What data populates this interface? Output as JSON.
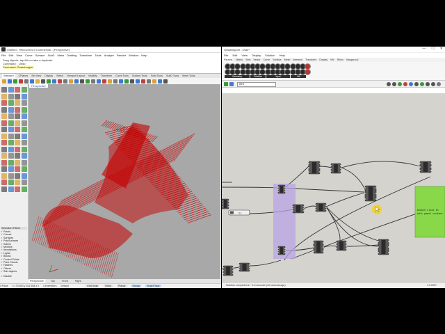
{
  "rhino": {
    "title": "Untitled - Rhinoceros 6 Commercial - [Perspective]",
    "menu": [
      "File",
      "Edit",
      "View",
      "Curve",
      "Surface",
      "SubD",
      "Mesh",
      "Drafting",
      "Transform",
      "Tools",
      "Analyze",
      "Render",
      "Window",
      "Help"
    ],
    "command_history": [
      "Drag objects, tap Alt to make a duplicate",
      "Command: _Undo"
    ],
    "command_prompt": "Command: Grasshopper",
    "toolbar_tabs": [
      "Standard",
      "CPlanes",
      "Set View",
      "Display",
      "Select",
      "Viewport Layout",
      "Visibility",
      "Transform",
      "Curve Tools",
      "Surface Tools",
      "Solid Tools",
      "SubD Tools",
      "Mesh Tools"
    ],
    "viewport_label": "Perspective",
    "viewport_tabs": [
      "Perspective",
      "Top",
      "Front",
      "Right"
    ],
    "selection_filters": {
      "header": "Selection Filters",
      "items": [
        "Points",
        "Curves",
        "Surfaces",
        "PolySurfaces",
        "SubDs",
        "Meshes",
        "Annotations",
        "Lights",
        "Blocks",
        "Control Points",
        "Point Clouds",
        "Hatches",
        "Others",
        "Sub-objects"
      ],
      "disable": "Disable"
    },
    "status": {
      "cplane": "CPlane",
      "coords": "x 179.853  y 161.658  z 0",
      "units": "Centimeters",
      "layer": "Default",
      "toggles": [
        "Grid Snap",
        "Ortho",
        "Planar",
        "Osnap",
        "SmartTrack"
      ]
    },
    "geometry_color": "#c40000"
  },
  "gh": {
    "title": "Grasshopper - chair*",
    "window_buttons": [
      "—",
      "☐",
      "✕"
    ],
    "menu": [
      "File",
      "Edit",
      "View",
      "Display",
      "Solution",
      "Help"
    ],
    "tabs": [
      "Params",
      "Maths",
      "Sets",
      "Vector",
      "Curve",
      "Surface",
      "Mesh",
      "Intersect",
      "Transform",
      "Display",
      "Wb",
      "Rhino",
      "Kangaroo2"
    ],
    "active_tab": "Params",
    "ribbon_groups": [
      "Geometry",
      "Primitive",
      "Input",
      "Util"
    ],
    "document_name": "chair",
    "zoom": "85%",
    "status": "Solution completed in ~4.0 seconds (10 seconds ago)",
    "version": "1.0.0007",
    "panel_text": "Double click to edit panel content…",
    "slider_value": "0.1",
    "panel_color": "#88d84a",
    "group_color": "#b9a4e6"
  }
}
